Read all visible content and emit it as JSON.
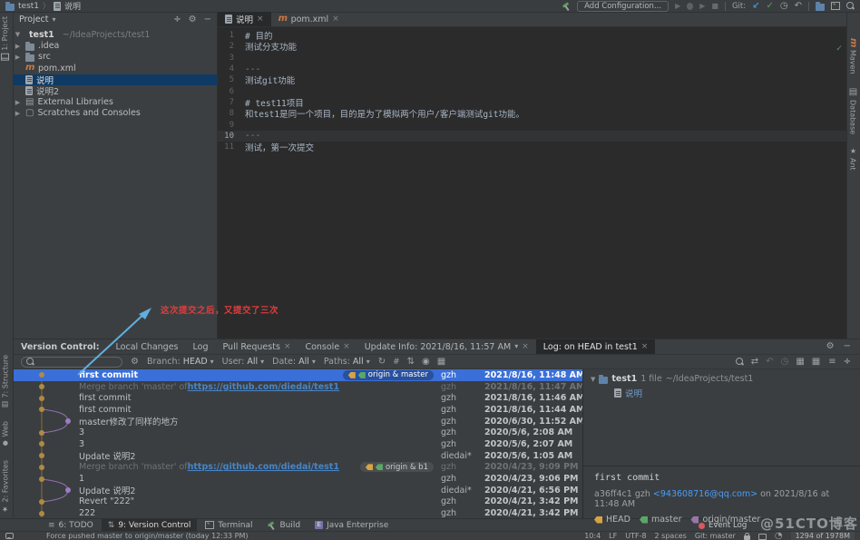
{
  "colors": {
    "selection_blue": "#3a6fd8",
    "tree_selection": "#0f3a63",
    "link_blue": "#4a9df6",
    "annotation_red": "#e13d3d",
    "arrow_blue": "#62aee0",
    "graph_gold": "#b08a45",
    "graph_purple": "#9d7cc4",
    "tag_yellow": "#d9a343",
    "tag_green": "#59a869",
    "tag_purple": "#9876aa",
    "event_log_red": "#db5860"
  },
  "titlebar": {
    "breadcrumb": [
      "test1",
      "说明"
    ],
    "add_configuration": "Add Configuration...",
    "git_label": "Git:"
  },
  "left_stripe": {
    "project": "1: Project",
    "structure": "7: Structure",
    "web": "Web",
    "favorites": "2: Favorites"
  },
  "right_stripe": {
    "maven": "Maven",
    "database": "Database",
    "ant": "Ant"
  },
  "project_panel": {
    "title": "Project",
    "tree": [
      {
        "label": "test1",
        "sublabel": "~/IdeaProjects/test1",
        "icon": "folderp",
        "expanded": true,
        "bold": true,
        "indent": 0
      },
      {
        "label": ".idea",
        "icon": "folder",
        "collapsed": true,
        "indent": 1
      },
      {
        "label": "src",
        "icon": "folder",
        "collapsed": true,
        "indent": 1
      },
      {
        "label": "pom.xml",
        "icon": "maven",
        "indent": 1
      },
      {
        "label": "说明",
        "icon": "file",
        "indent": 1,
        "selected": true
      },
      {
        "label": "说明2",
        "icon": "file",
        "indent": 1
      },
      {
        "label": "External Libraries",
        "icon": "libs",
        "collapsed": true,
        "indent": 0
      },
      {
        "label": "Scratches and Consoles",
        "icon": "scr",
        "collapsed": true,
        "indent": 0
      }
    ]
  },
  "editor": {
    "tabs": [
      {
        "label": "说明",
        "icon": "file",
        "active": true
      },
      {
        "label": "pom.xml",
        "icon": "maven"
      }
    ],
    "lines": [
      {
        "n": "1",
        "text": "# 目的"
      },
      {
        "n": "2",
        "text": "测试分支功能"
      },
      {
        "n": "3",
        "text": ""
      },
      {
        "n": "4",
        "text": "---",
        "hr": true
      },
      {
        "n": "5",
        "text": "测试git功能"
      },
      {
        "n": "6",
        "text": ""
      },
      {
        "n": "7",
        "text": "# test11项目"
      },
      {
        "n": "8",
        "text": "和test1是同一个项目，目的是为了模拟两个用户/客户端测试git功能。"
      },
      {
        "n": "9",
        "text": ""
      },
      {
        "n": "10",
        "text": "---",
        "hr": true,
        "current": true
      },
      {
        "n": "11",
        "text": "测试，第一次提交"
      }
    ]
  },
  "annotation": {
    "text": "这次提交之后，又提交了三次"
  },
  "vc": {
    "label": "Version Control:",
    "tabs": [
      {
        "label": "Local Changes"
      },
      {
        "label": "Log"
      },
      {
        "label": "Pull Requests",
        "close": true
      },
      {
        "label": "Console",
        "close": true
      },
      {
        "label": "Update Info: 2021/8/16, 11:57 AM",
        "dropdown": true,
        "close": true
      },
      {
        "label": "Log: on HEAD in test1",
        "close": true,
        "active": true
      }
    ],
    "filters": {
      "branch_label": "Branch:",
      "branch": "HEAD",
      "user_label": "User:",
      "user": "All",
      "date_label": "Date:",
      "date": "All",
      "paths_label": "Paths:",
      "paths": "All"
    },
    "log_rows": [
      {
        "message": "first commit",
        "refs": "origin & master",
        "author": "gzh",
        "date": "2021/8/16, 11:48 AM",
        "selected": true
      },
      {
        "message": "Merge branch 'master' of ",
        "link": "https://github.com/diedai/test1",
        "author": "gzh",
        "date": "2021/8/16, 11:47 AM",
        "faded": true
      },
      {
        "message": "first commit",
        "author": "gzh",
        "date": "2021/8/16, 11:46 AM"
      },
      {
        "message": "first commit",
        "author": "gzh",
        "date": "2021/8/16, 11:44 AM"
      },
      {
        "message": "master修改了同样的地方",
        "author": "gzh",
        "date": "2020/6/30, 11:52 AM",
        "purple": true
      },
      {
        "message": "3",
        "author": "gzh",
        "date": "2020/5/6, 2:08 AM"
      },
      {
        "message": "3",
        "author": "gzh",
        "date": "2020/5/6, 2:07 AM"
      },
      {
        "message": "Update 说明2",
        "author": "diedai*",
        "date": "2020/5/6, 1:05 AM"
      },
      {
        "message": "Merge branch 'master' of ",
        "link": "https://github.com/diedai/test1",
        "refs": "origin & b1",
        "author": "gzh",
        "date": "2020/4/23, 9:09 PM",
        "faded": true
      },
      {
        "message": "1",
        "author": "gzh",
        "date": "2020/4/23, 9:06 PM"
      },
      {
        "message": "Update 说明2",
        "author": "diedai*",
        "date": "2020/4/21, 6:56 PM",
        "purple": true
      },
      {
        "message": "Revert \"222\"",
        "author": "gzh",
        "date": "2020/4/21, 3:42 PM"
      },
      {
        "message": "222",
        "author": "gzh",
        "date": "2020/4/21, 3:42 PM"
      }
    ]
  },
  "details": {
    "root": "test1",
    "count": "1 file",
    "path": "~/IdeaProjects/test1",
    "file": "说明",
    "commit_message": "first commit",
    "hash": "a36ff4c1",
    "author": "gzh",
    "email": "<943608716@qq.com>",
    "when": "on 2021/8/16 at 11:48 AM",
    "refs": [
      {
        "name": "HEAD",
        "color": "#d9a343"
      },
      {
        "name": "master",
        "color": "#59a869"
      },
      {
        "name": "origin/master",
        "color": "#9876aa"
      }
    ]
  },
  "bottom_bar": {
    "items": [
      {
        "label": "6: TODO",
        "icon": "list"
      },
      {
        "label": "9: Version Control",
        "icon": "vcsbr",
        "active": true
      },
      {
        "label": "Terminal",
        "icon": "term"
      },
      {
        "label": "Build",
        "icon": "hammer"
      },
      {
        "label": "Java Enterprise",
        "icon": "javaee"
      }
    ]
  },
  "status_bar": {
    "message": "Force pushed master to origin/master (today 12:33 PM)",
    "position": "10:4",
    "line_sep": "LF",
    "encoding": "UTF-8",
    "indent": "2 spaces",
    "branch": "Git: master",
    "memory": "1294 of 1978M"
  },
  "watermark": "@51CTO博客",
  "event_log": "Event Log"
}
